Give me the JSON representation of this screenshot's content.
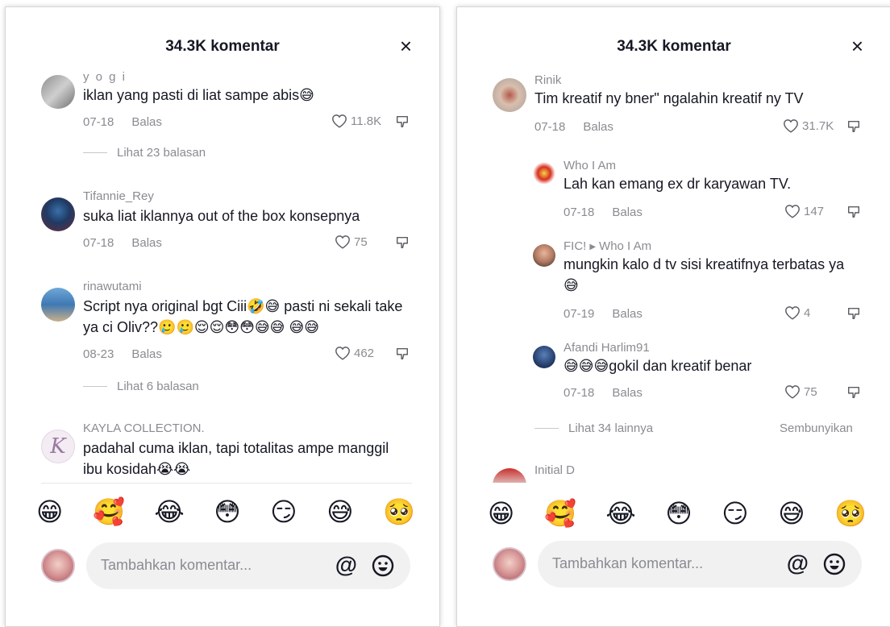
{
  "left": {
    "title": "34.3K komentar",
    "close_symbol": "×",
    "comments": [
      {
        "user": "y o g i",
        "text": "iklan yang pasti di liat sampe abis😅",
        "date": "07-18",
        "reply": "Balas",
        "likes": "11.8K",
        "more": "Lihat 23 balasan"
      },
      {
        "user": "Tifannie_Rey",
        "text": "suka liat iklannya out of the box konsepnya",
        "date": "07-18",
        "reply": "Balas",
        "likes": "75"
      },
      {
        "user": "rinawutami",
        "text": "Script nya original bgt Ciii🤣😅 pasti ni sekali take ya ci Oliv??🥲🥲😌😌😳😳😅😅 😅😅",
        "date": "08-23",
        "reply": "Balas",
        "likes": "462",
        "more": "Lihat 6 balasan"
      },
      {
        "user": "KAYLA COLLECTION.",
        "text": "padahal cuma iklan, tapi totalitas ampe manggil ibu kosidah😭😭",
        "avatar_letter": "K"
      }
    ],
    "emojis": [
      "😁",
      "🥰",
      "😂",
      "😳",
      "😏",
      "😅",
      "🥺"
    ],
    "placeholder": "Tambahkan komentar...",
    "at_symbol": "@"
  },
  "right": {
    "title": "34.3K komentar",
    "close_symbol": "×",
    "comments": [
      {
        "user": "Rinik",
        "text": "Tim kreatif ny bner\" ngalahin kreatif ny TV",
        "date": "07-18",
        "reply": "Balas",
        "likes": "31.7K"
      },
      {
        "user": "Who I Am",
        "text": "Lah kan emang ex dr karyawan TV.",
        "date": "07-18",
        "reply": "Balas",
        "likes": "147"
      },
      {
        "user": "FIC!",
        "reply_to": "Who I Am",
        "text": "mungkin kalo d tv sisi kreatifnya terbatas ya 😅",
        "date": "07-19",
        "reply": "Balas",
        "likes": "4"
      },
      {
        "user": "Afandi Harlim91",
        "text": "😅😅😅gokil dan kreatif benar",
        "date": "07-18",
        "reply": "Balas",
        "likes": "75"
      },
      {
        "user": "Initial D"
      }
    ],
    "more": "Lihat 34 lainnya",
    "hide": "Sembunyikan",
    "emojis": [
      "😁",
      "🥰",
      "😂",
      "😳",
      "😏",
      "😅",
      "🥺"
    ],
    "placeholder": "Tambahkan komentar...",
    "at_symbol": "@"
  }
}
